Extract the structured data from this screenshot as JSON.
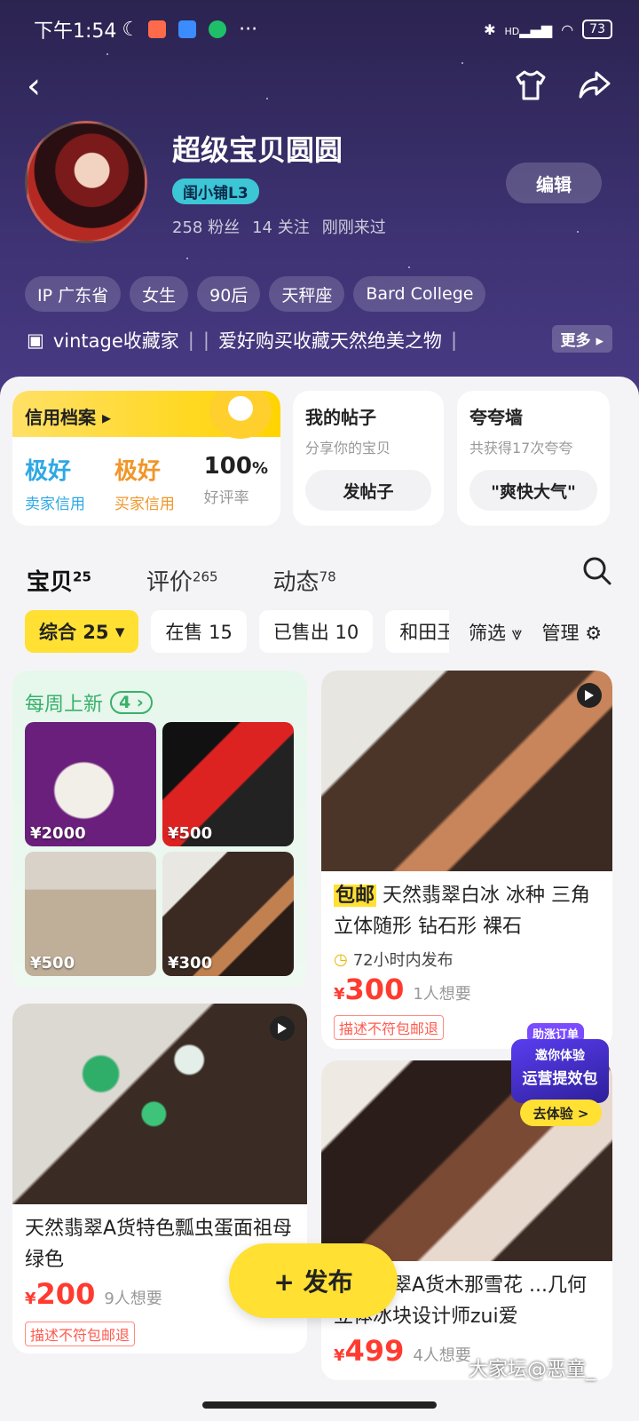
{
  "status_bar": {
    "time": "下午1:54",
    "dots": "···",
    "network": "HD",
    "battery": "73"
  },
  "profile": {
    "name": "超级宝贝圆圆",
    "level": "闺小铺L3",
    "stats": [
      "258 粉丝",
      "14 关注",
      "刚刚来过"
    ],
    "edit_label": "编辑",
    "tags": [
      "IP 广东省",
      "女生",
      "90后",
      "天秤座",
      "Bard College"
    ],
    "bio_items": [
      "vintage收藏家",
      "爱好购买收藏天然绝美之物"
    ],
    "more_label": "更多"
  },
  "credit": {
    "title": "信用档案",
    "seller_value": "极好",
    "seller_label": "卖家信用",
    "buyer_value": "极好",
    "buyer_label": "买家信用",
    "rate_value": "100",
    "rate_unit": "%",
    "rate_label": "好评率"
  },
  "posts_card": {
    "title": "我的帖子",
    "subtitle": "分享你的宝贝",
    "button": "发帖子"
  },
  "wall_card": {
    "title": "夸夸墙",
    "subtitle": "共获得17次夸夸",
    "button": "\"爽快大气\""
  },
  "tabs": [
    {
      "label": "宝贝",
      "count": "25"
    },
    {
      "label": "评价",
      "count": "265"
    },
    {
      "label": "动态",
      "count": "78"
    }
  ],
  "filters": [
    "综合 25",
    "在售 15",
    "已售出 10",
    "和田玉"
  ],
  "filter_actions": {
    "filter": "筛选",
    "manage": "管理"
  },
  "weekly": {
    "title": "每周上新",
    "count": "4",
    "prices": [
      "¥2000",
      "¥500",
      "¥500",
      "¥300"
    ]
  },
  "items": [
    {
      "badge": "包邮",
      "title": "天然翡翠白冰 冰种 三角立体随形 钻石形 裸石",
      "note": "72小时内发布",
      "price_symbol": "¥",
      "price": "300",
      "want": "1人想要",
      "tag": "描述不符包邮退"
    },
    {
      "title": "天然翡翠A货特色瓢虫蛋面祖母绿色",
      "price_symbol": "¥",
      "price": "200",
      "want": "9人想要",
      "tag": "描述不符包邮退"
    },
    {
      "title": "天然翡翠A货木那雪花 ...几何立体冰块设计师zui爱",
      "price_symbol": "¥",
      "price": "499",
      "want": "4人想要"
    }
  ],
  "promo": {
    "top": "助涨订单",
    "line1": "邀你体验",
    "line2": "运营提效包",
    "button": "去体验 >"
  },
  "publish_label": "+ 发布",
  "watermark": "大家坛@恶童_"
}
